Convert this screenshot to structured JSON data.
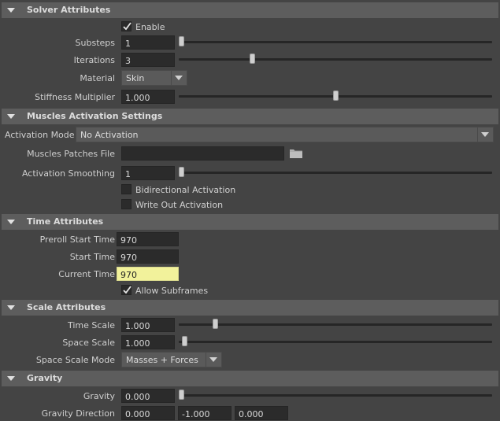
{
  "solver": {
    "title": "Solver Attributes",
    "enable_label": "Enable",
    "enable_checked": true,
    "substeps_label": "Substeps",
    "substeps_value": "1",
    "substeps_level": 0.0,
    "iterations_label": "Iterations",
    "iterations_value": "3",
    "iterations_level": 0.23,
    "material_label": "Material",
    "material_value": "Skin",
    "stiffness_label": "Stiffness Multiplier",
    "stiffness_value": "1.000",
    "stiffness_level": 0.5
  },
  "muscles": {
    "title": "Muscles Activation Settings",
    "activation_mode_label": "Activation Mode",
    "activation_mode_value": "No Activation",
    "patches_file_label": "Muscles Patches File",
    "patches_file_value": "",
    "smoothing_label": "Activation Smoothing",
    "smoothing_value": "1",
    "smoothing_level": 0.0,
    "bidirectional_label": "Bidirectional Activation",
    "bidirectional_checked": false,
    "write_out_label": "Write Out Activation",
    "write_out_checked": false
  },
  "time": {
    "title": "Time Attributes",
    "preroll_label": "Preroll Start Time",
    "preroll_value": "970",
    "start_label": "Start Time",
    "start_value": "970",
    "current_label": "Current Time",
    "current_value": "970",
    "subframes_label": "Allow Subframes",
    "subframes_checked": true
  },
  "scale": {
    "title": "Scale Attributes",
    "time_scale_label": "Time Scale",
    "time_scale_value": "1.000",
    "time_scale_level": 0.11,
    "space_scale_label": "Space Scale",
    "space_scale_value": "1.000",
    "space_scale_level": 0.01,
    "space_scale_mode_label": "Space Scale Mode",
    "space_scale_mode_value": "Masses + Forces"
  },
  "gravity": {
    "title": "Gravity",
    "gravity_label": "Gravity",
    "gravity_value": "0.000",
    "gravity_level": 0.0,
    "direction_label": "Gravity Direction",
    "direction_x": "0.000",
    "direction_y": "-1.000",
    "direction_z": "0.000"
  },
  "icons": {
    "section_toggle": "triangle-down-icon",
    "check": "checkmark-icon",
    "folder": "folder-icon",
    "dropdown": "caret-down-icon"
  },
  "colors": {
    "background": "#444444",
    "header": "#5d5d5d",
    "field": "#2b2b2b",
    "current_time_highlight": "#f2f29b"
  }
}
